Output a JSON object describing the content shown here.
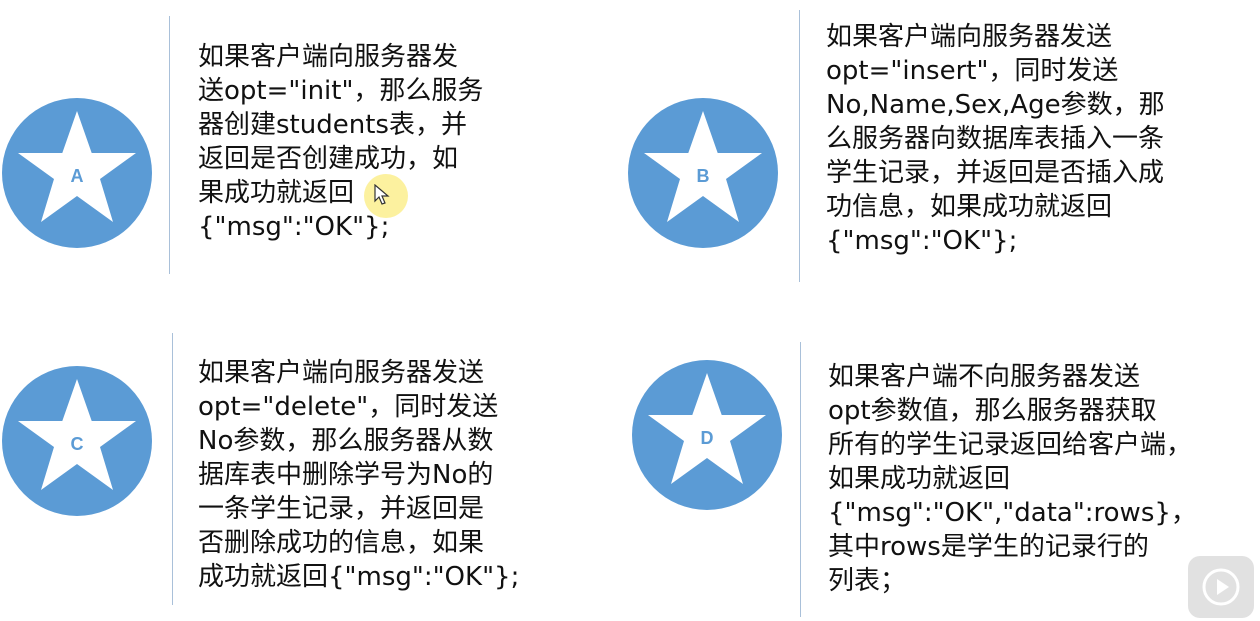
{
  "colors": {
    "circle": "#5b9bd5",
    "star": "#ffffff",
    "divider": "#a9c0d9",
    "text": "#111111"
  },
  "cards": [
    {
      "label": "A",
      "icon": "star-icon",
      "text": "如果客户端向服务器发\n送opt=\"init\"，那么服务\n器创建students表，并\n返回是否创建成功，如\n果成功就返回\n{\"msg\":\"OK\"};"
    },
    {
      "label": "B",
      "icon": "star-icon",
      "text": "如果客户端向服务器发送\nopt=\"insert\"，同时发送\nNo,Name,Sex,Age参数，那\n么服务器向数据库表插入一条\n学生记录，并返回是否插入成\n功信息，如果成功就返回\n{\"msg\":\"OK\"};"
    },
    {
      "label": "C",
      "icon": "star-icon",
      "text": "如果客户端向服务器发送\nopt=\"delete\"，同时发送\nNo参数，那么服务器从数\n据库表中删除学号为No的\n一条学生记录，并返回是\n否删除成功的信息，如果\n成功就返回{\"msg\":\"OK\"};"
    },
    {
      "label": "D",
      "icon": "star-icon",
      "text": "如果客户端不向服务器发送\nopt参数值，那么服务器获取\n所有的学生记录返回给客户端，\n如果成功就返回\n{\"msg\":\"OK\",\"data\":rows}，\n其中rows是学生的记录行的\n列表；"
    }
  ],
  "overlay": {
    "cursor_icon": "mouse-pointer-icon",
    "play_icon": "play-icon"
  }
}
